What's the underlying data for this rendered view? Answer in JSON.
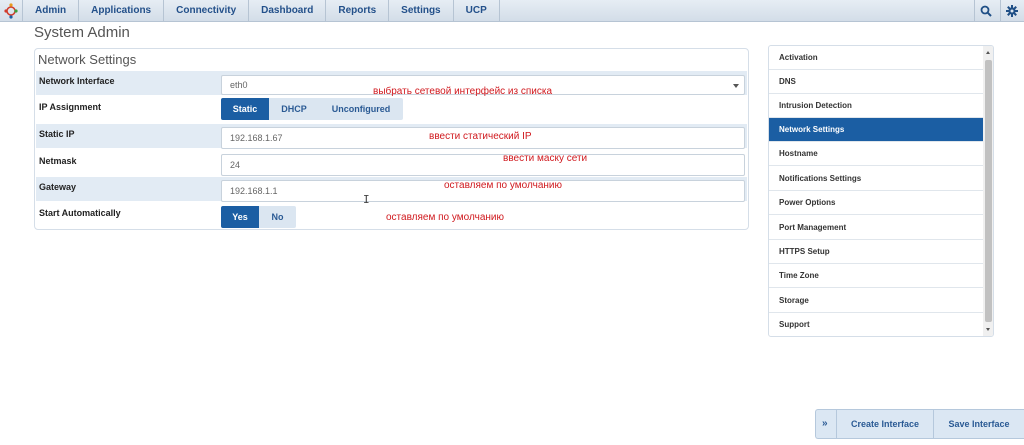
{
  "nav": {
    "items": [
      "Admin",
      "Applications",
      "Connectivity",
      "Dashboard",
      "Reports",
      "Settings",
      "UCP"
    ],
    "search_icon": "search-icon",
    "settings_icon": "gear-icon"
  },
  "page": {
    "title": "System Admin"
  },
  "network_settings": {
    "title": "Network Settings",
    "interface": {
      "label": "Network Interface",
      "value": "eth0",
      "note": "выбрать сетевой интерфейс из списка"
    },
    "ip_assignment": {
      "label": "IP Assignment",
      "options": [
        "Static",
        "DHCP",
        "Unconfigured"
      ],
      "selected": "Static"
    },
    "static_ip": {
      "label": "Static IP",
      "value": "192.168.1.67",
      "note": "ввести статический IP"
    },
    "netmask": {
      "label": "Netmask",
      "value": "24",
      "note": "ввести маску сети"
    },
    "gateway": {
      "label": "Gateway",
      "value": "192.168.1.1",
      "note": "оставляем по умолчанию"
    },
    "start_automatically": {
      "label": "Start Automatically",
      "options": [
        "Yes",
        "No"
      ],
      "selected": "Yes",
      "note": "оставляем по умолчанию"
    }
  },
  "sidebar": {
    "items": [
      "Activation",
      "DNS",
      "Intrusion Detection",
      "Network Settings",
      "Hostname",
      "Notifications Settings",
      "Power Options",
      "Port Management",
      "HTTPS Setup",
      "Time Zone",
      "Storage",
      "Support"
    ],
    "active": "Network Settings"
  },
  "actions": {
    "expand_glyph": "»",
    "create": "Create Interface",
    "save": "Save Interface"
  },
  "colors": {
    "accent": "#1b5ea3",
    "note": "#d0191e",
    "row_shade": "#e2ebf4"
  }
}
